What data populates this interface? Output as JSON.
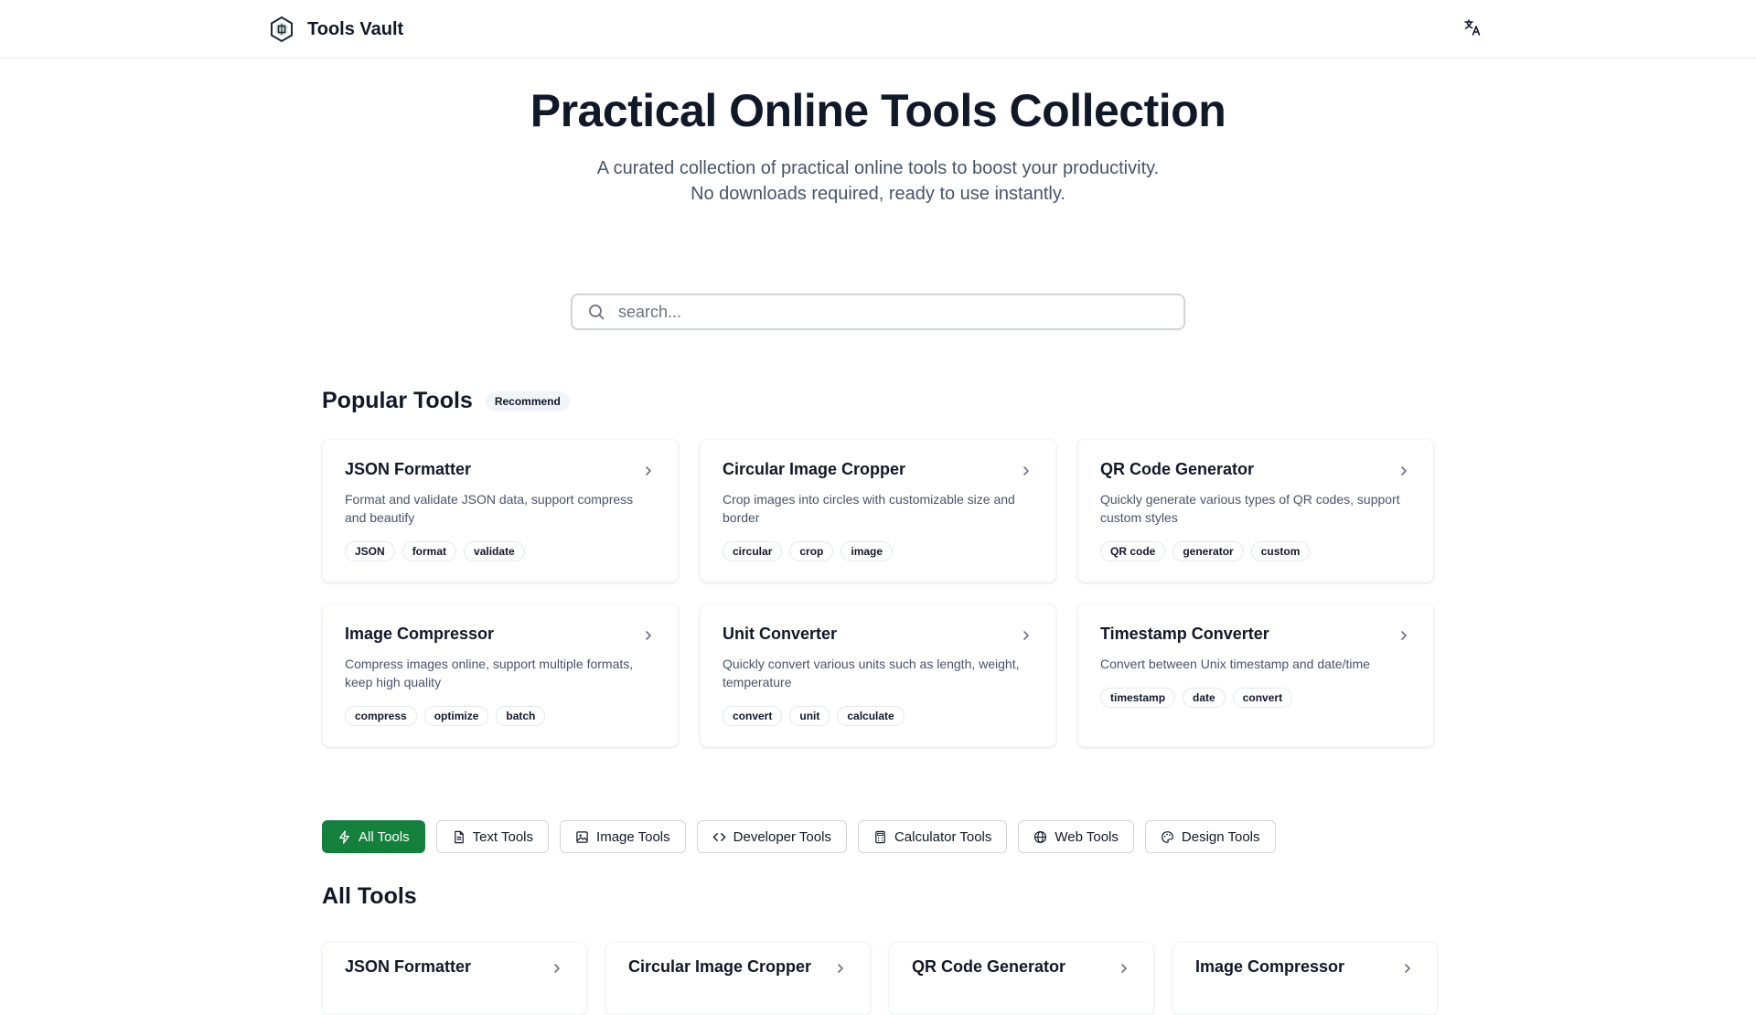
{
  "header": {
    "brand_name": "Tools Vault",
    "logo_icon": "hexagon-logo-icon",
    "language_icon": "translate-icon"
  },
  "hero": {
    "title": "Practical Online Tools Collection",
    "subtitle_line1": "A curated collection of practical online tools to boost your productivity.",
    "subtitle_line2": "No downloads required, ready to use instantly."
  },
  "search": {
    "placeholder": "search...",
    "value": ""
  },
  "popular": {
    "title": "Popular Tools",
    "badge": "Recommend",
    "cards": [
      {
        "title": "JSON Formatter",
        "desc": "Format and validate JSON data, support compress and beautify",
        "tags": [
          "JSON",
          "format",
          "validate"
        ]
      },
      {
        "title": "Circular Image Cropper",
        "desc": "Crop images into circles with customizable size and border",
        "tags": [
          "circular",
          "crop",
          "image"
        ]
      },
      {
        "title": "QR Code Generator",
        "desc": "Quickly generate various types of QR codes, support custom styles",
        "tags": [
          "QR code",
          "generator",
          "custom"
        ]
      },
      {
        "title": "Image Compressor",
        "desc": "Compress images online, support multiple formats, keep high quality",
        "tags": [
          "compress",
          "optimize",
          "batch"
        ]
      },
      {
        "title": "Unit Converter",
        "desc": "Quickly convert various units such as length, weight, temperature",
        "tags": [
          "convert",
          "unit",
          "calculate"
        ]
      },
      {
        "title": "Timestamp Converter",
        "desc": "Convert between Unix timestamp and date/time",
        "tags": [
          "timestamp",
          "date",
          "convert"
        ]
      }
    ]
  },
  "filters": [
    {
      "label": "All Tools",
      "icon": "zap-icon",
      "active": true
    },
    {
      "label": "Text Tools",
      "icon": "file-text-icon",
      "active": false
    },
    {
      "label": "Image Tools",
      "icon": "image-icon",
      "active": false
    },
    {
      "label": "Developer Tools",
      "icon": "code-icon",
      "active": false
    },
    {
      "label": "Calculator Tools",
      "icon": "calculator-icon",
      "active": false
    },
    {
      "label": "Web Tools",
      "icon": "globe-icon",
      "active": false
    },
    {
      "label": "Design Tools",
      "icon": "palette-icon",
      "active": false
    }
  ],
  "all_tools": {
    "title": "All Tools",
    "cards": [
      {
        "title": "JSON Formatter"
      },
      {
        "title": "Circular Image Cropper"
      },
      {
        "title": "QR Code Generator"
      },
      {
        "title": "Image Compressor"
      }
    ]
  },
  "colors": {
    "accent": "#15803d",
    "text": "#111827",
    "muted": "#475569"
  }
}
